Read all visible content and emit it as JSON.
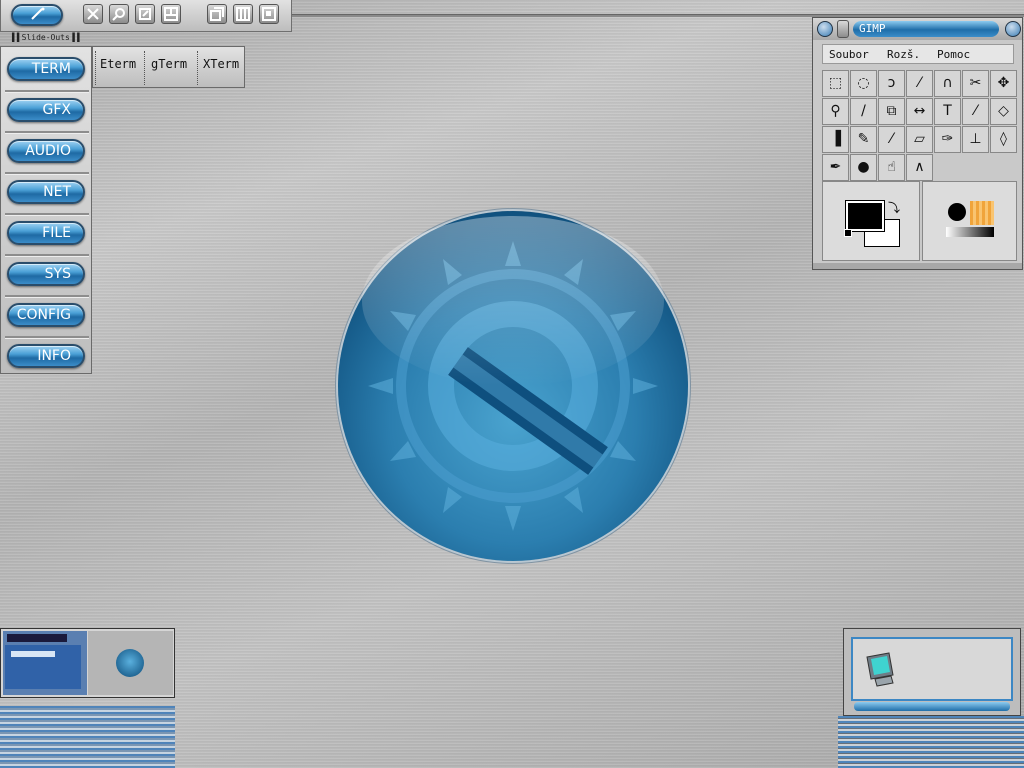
{
  "toolbar": {
    "slideouts_label": "Slide-Outs",
    "buttons": [
      "wand-icon",
      "close-icon",
      "magnifier-icon",
      "restore-icon",
      "layout-icon",
      "cascade-icon",
      "tile-icon",
      "desktop-icon"
    ]
  },
  "launcher": {
    "items": [
      "TERM",
      "GFX",
      "AUDIO",
      "NET",
      "FILE",
      "SYS",
      "CONFIG",
      "INFO"
    ],
    "term_slideout": [
      "Eterm",
      "gTerm",
      "XTerm"
    ]
  },
  "gimp": {
    "title": "GIMP",
    "menu": [
      "Soubor",
      "Rozš.",
      "Pomoc"
    ],
    "fg_color": "#000000",
    "bg_color": "#ffffff"
  },
  "colors": {
    "accent": "#2b7eaf",
    "orb_dark": "#083b60"
  }
}
